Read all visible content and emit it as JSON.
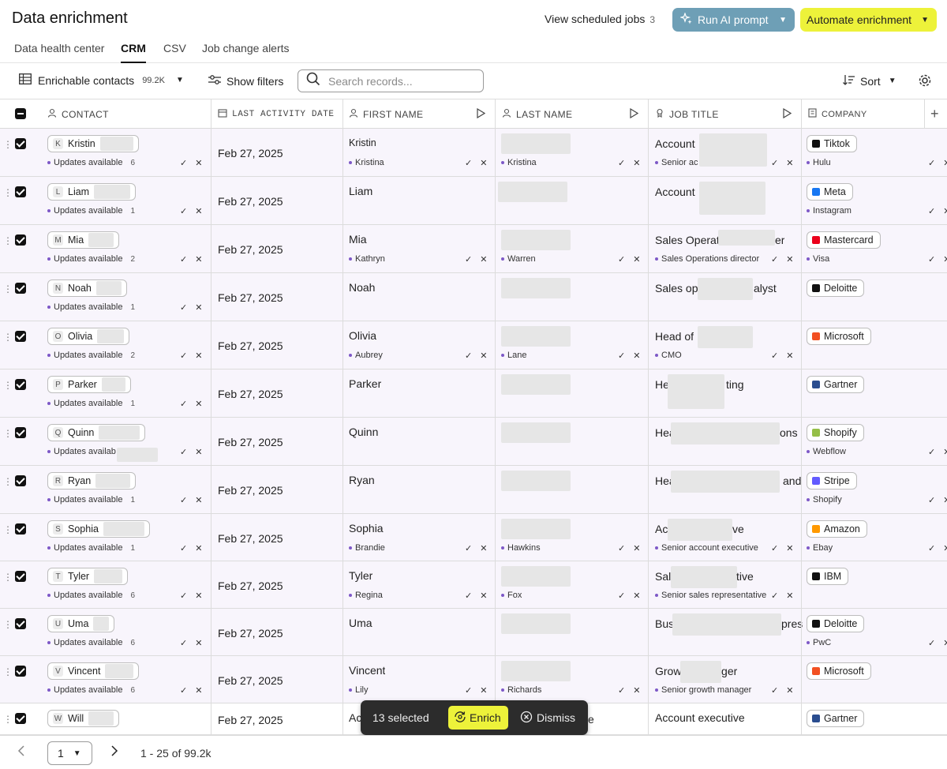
{
  "header": {
    "title": "Data enrichment",
    "scheduled_label": "View scheduled jobs",
    "scheduled_count": "3",
    "ai_button": "Run AI prompt",
    "automate_button": "Automate enrichment"
  },
  "tabs": [
    "Data health center",
    "CRM",
    "CSV",
    "Job change alerts"
  ],
  "toolbar": {
    "view_label": "Enrichable contacts",
    "view_count": "99.2K",
    "filters_label": "Show filters",
    "search_placeholder": "Search records...",
    "sort_label": "Sort"
  },
  "columns": [
    "CONTACT",
    "LAST ACTIVITY DATE",
    "FIRST NAME",
    "LAST NAME",
    "JOB TITLE",
    "COMPANY"
  ],
  "rows": [
    {
      "initial": "K",
      "name": "Kristin",
      "updates": "Updates available",
      "count": "6",
      "date": "Feb 27, 2025",
      "first": "Kristin",
      "first_sub": "Kristina",
      "last": "",
      "last_sub": "Kristina",
      "job": "Account",
      "job_sub": "Senior ac",
      "company": "Tiktok",
      "company_sub": "Hulu"
    },
    {
      "initial": "L",
      "name": "Liam",
      "updates": "Updates available",
      "count": "1",
      "date": "Feb 27, 2025",
      "first": "Liam",
      "first_sub": "",
      "last": "",
      "last_sub": "",
      "job": "Account",
      "job_sub": "",
      "company": "Meta",
      "company_sub": "Instagram"
    },
    {
      "initial": "M",
      "name": "Mia",
      "updates": "Updates available",
      "count": "2",
      "date": "Feb 27, 2025",
      "first": "Mia",
      "first_sub": "Kathryn",
      "last": "",
      "last_sub": "Warren",
      "job": "Sales Operat",
      "job_tail": "er",
      "job_sub": "Sales Operations director",
      "company": "Mastercard",
      "company_sub": "Visa"
    },
    {
      "initial": "N",
      "name": "Noah",
      "updates": "Updates available",
      "count": "1",
      "date": "Feb 27, 2025",
      "first": "Noah",
      "first_sub": "",
      "last": "",
      "last_sub": "",
      "job": "Sales op",
      "job_tail": "alyst",
      "job_sub": "",
      "company": "Deloitte",
      "company_sub": ""
    },
    {
      "initial": "O",
      "name": "Olivia",
      "updates": "Updates available",
      "count": "2",
      "date": "Feb 27, 2025",
      "first": "Olivia",
      "first_sub": "Aubrey",
      "last": "",
      "last_sub": "Lane",
      "job": "Head of",
      "job_sub": "CMO",
      "company": "Microsoft",
      "company_sub": ""
    },
    {
      "initial": "P",
      "name": "Parker",
      "updates": "Updates available",
      "count": "1",
      "date": "Feb 27, 2025",
      "first": "Parker",
      "first_sub": "",
      "last": "",
      "last_sub": "",
      "job": "He",
      "job_tail": "ting",
      "job_sub": "",
      "company": "Gartner",
      "company_sub": ""
    },
    {
      "initial": "Q",
      "name": "Quinn",
      "updates": "Updates availab",
      "count": "",
      "date": "Feb 27, 2025",
      "first": "Quinn",
      "first_sub": "",
      "last": "",
      "last_sub": "",
      "job": "Hea",
      "job_tail": "ons",
      "job_sub": "",
      "company": "Shopify",
      "company_sub": "Webflow"
    },
    {
      "initial": "R",
      "name": "Ryan",
      "updates": "Updates available",
      "count": "1",
      "date": "Feb 27, 2025",
      "first": "Ryan",
      "first_sub": "",
      "last": "",
      "last_sub": "",
      "job": "Hea",
      "job_tail": "and",
      "job_sub": "",
      "company": "Stripe",
      "company_sub": "Shopify"
    },
    {
      "initial": "S",
      "name": "Sophia",
      "updates": "Updates available",
      "count": "1",
      "date": "Feb 27, 2025",
      "first": "Sophia",
      "first_sub": "Brandie",
      "last": "",
      "last_sub": "Hawkins",
      "job": "Ac",
      "job_tail": "ve",
      "job_sub": "Senior account executive",
      "company": "Amazon",
      "company_sub": "Ebay"
    },
    {
      "initial": "T",
      "name": "Tyler",
      "updates": "Updates available",
      "count": "6",
      "date": "Feb 27, 2025",
      "first": "Tyler",
      "first_sub": "Regina",
      "last": "",
      "last_sub": "Fox",
      "job": "Sale",
      "job_tail": "tive",
      "job_sub": "Senior sales representative",
      "company": "IBM",
      "company_sub": ""
    },
    {
      "initial": "U",
      "name": "Uma",
      "updates": "Updates available",
      "count": "6",
      "date": "Feb 27, 2025",
      "first": "Uma",
      "first_sub": "",
      "last": "",
      "last_sub": "",
      "job": "Bus",
      "job_tail": "pres",
      "job_sub": "",
      "company": "Deloitte",
      "company_sub": "PwC"
    },
    {
      "initial": "V",
      "name": "Vincent",
      "updates": "Updates available",
      "count": "6",
      "date": "Feb 27, 2025",
      "first": "Vincent",
      "first_sub": "Lily",
      "last": "",
      "last_sub": "Richards",
      "job": "Growth Manager",
      "job_sub": "Senior growth manager",
      "company": "Microsoft",
      "company_sub": ""
    },
    {
      "initial": "W",
      "name": "Will",
      "updates": "",
      "count": "",
      "date": "Feb 27, 2025",
      "first": "Ac",
      "first_sub": "",
      "last": "",
      "last_sub": "",
      "job": "Account executive",
      "job_sub": "",
      "company": "Gartner",
      "company_sub": ""
    }
  ],
  "selection": {
    "count_label": "13 selected",
    "enrich": "Enrich",
    "dismiss": "Dismiss",
    "last_name_tail": "e"
  },
  "pagination": {
    "page": "1",
    "range": "1 - 25 of 99.2k"
  },
  "colors": {
    "ai_button": "#6e9fb6",
    "accent_yellow": "#edf23a",
    "row_highlight": "#f8f5fc",
    "update_dot": "#7d58c7"
  },
  "company_logos": {
    "Tiktok": {
      "icon": "tiktok-logo",
      "color": "#111111"
    },
    "Meta": {
      "icon": "meta-logo",
      "color": "#1877f2"
    },
    "Mastercard": {
      "icon": "mastercard-logo",
      "color": "#eb001b"
    },
    "Deloitte": {
      "icon": "deloitte-logo",
      "color": "#111111"
    },
    "Microsoft": {
      "icon": "microsoft-logo",
      "color": "#f25022"
    },
    "Gartner": {
      "icon": "gartner-logo",
      "color": "#2a4d8f"
    },
    "Shopify": {
      "icon": "shopify-logo",
      "color": "#95bf47"
    },
    "Stripe": {
      "icon": "stripe-logo",
      "color": "#635bff"
    },
    "Amazon": {
      "icon": "amazon-logo",
      "color": "#ff9900"
    },
    "IBM": {
      "icon": "ibm-logo",
      "color": "#111111"
    }
  }
}
